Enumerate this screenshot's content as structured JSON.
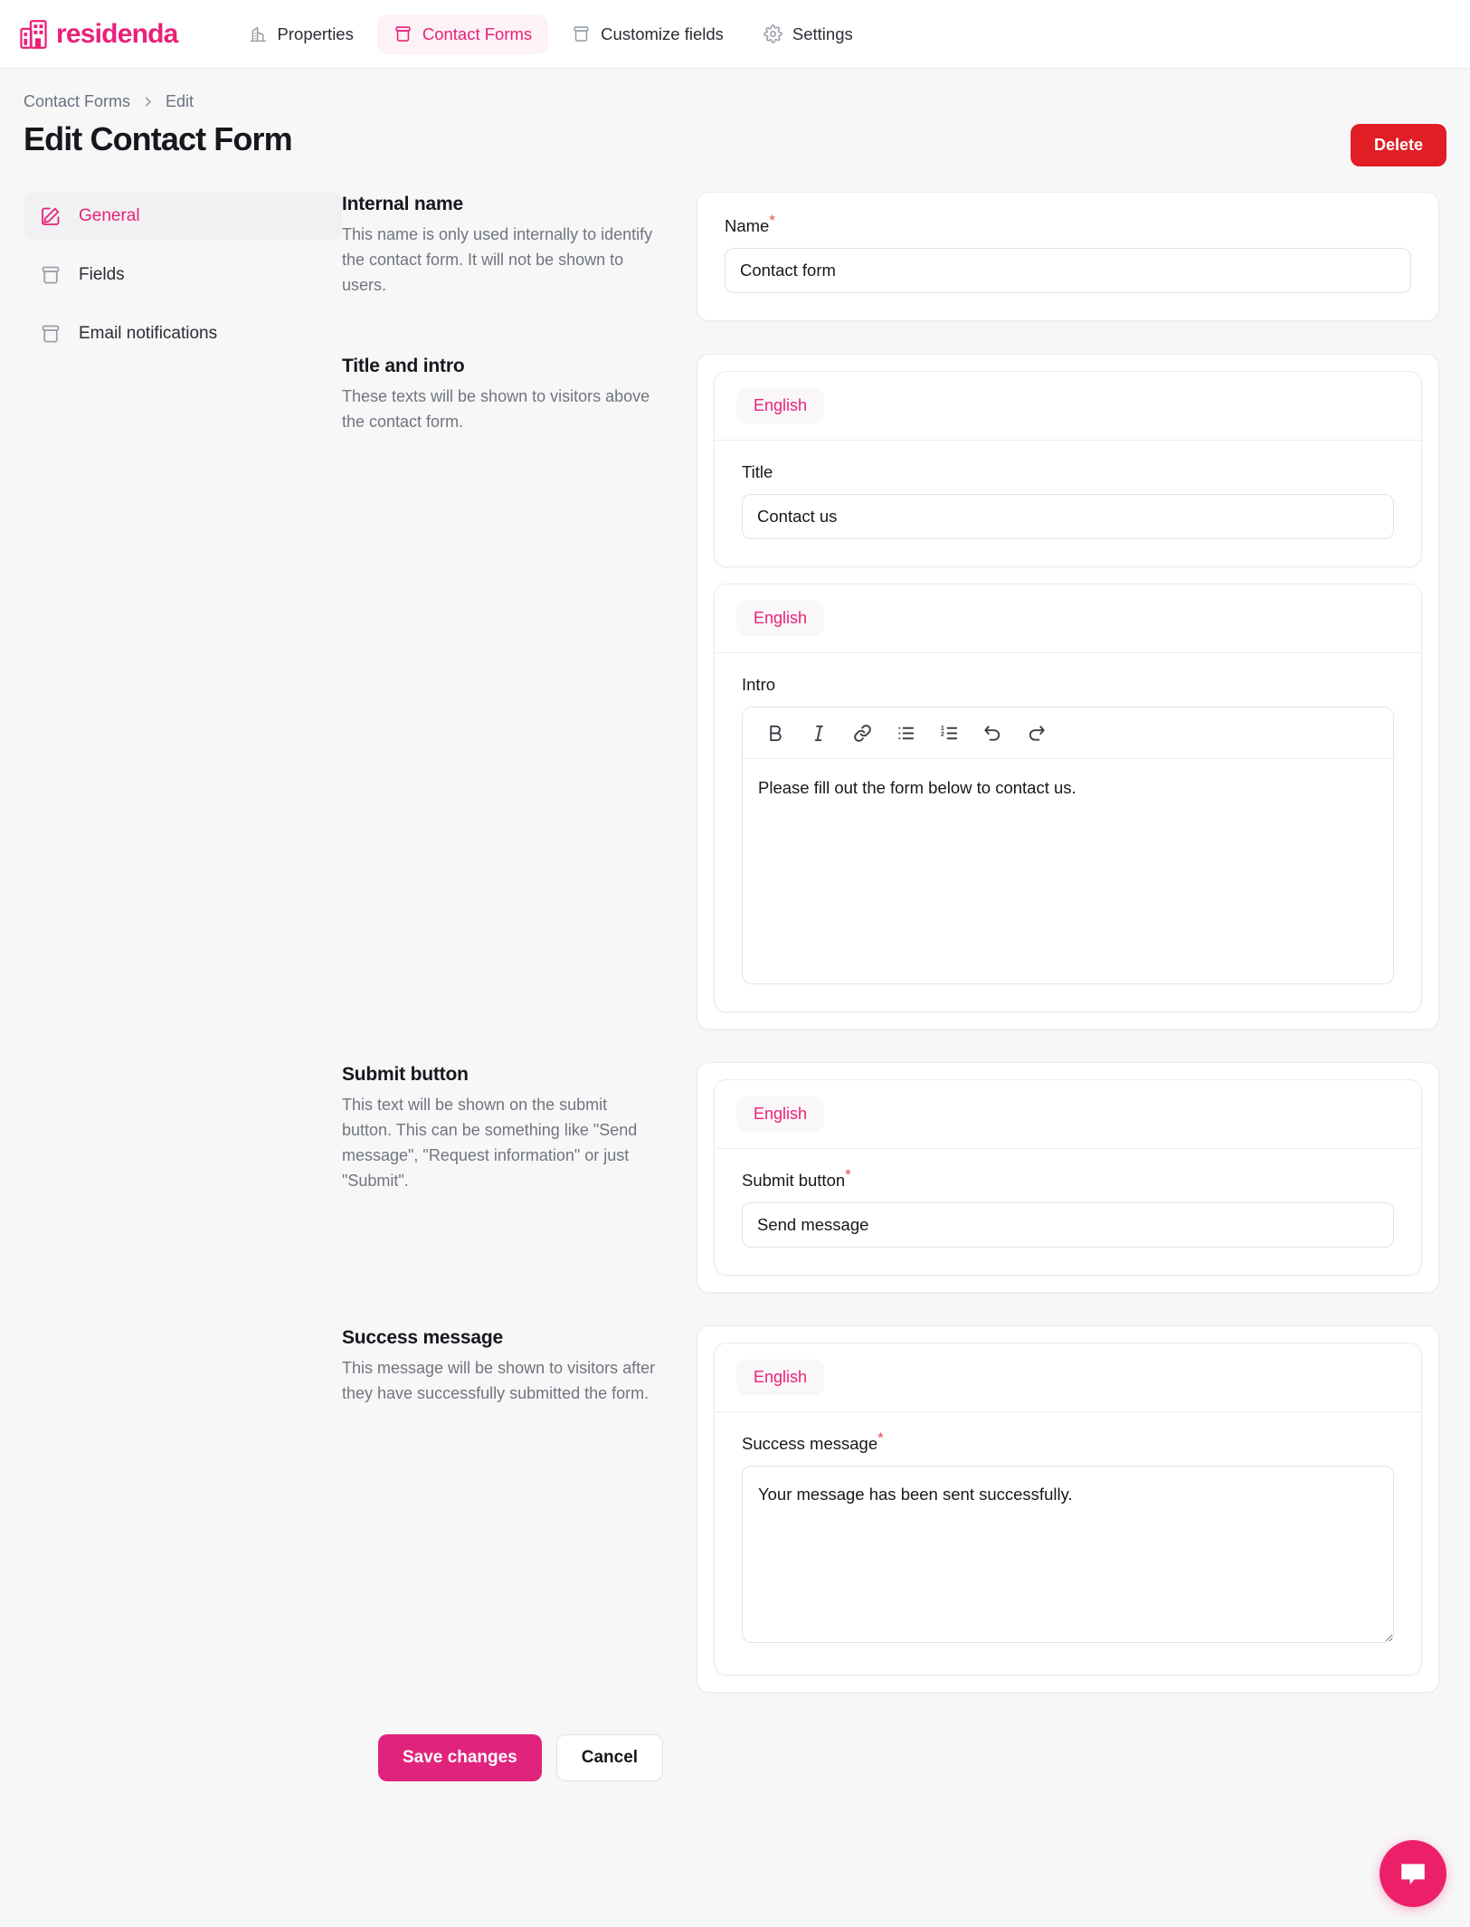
{
  "brand": {
    "name": "residenda",
    "accent": "#e8217a",
    "logo_icon": "building-icon"
  },
  "nav": {
    "items": [
      {
        "label": "Properties",
        "icon": "building-chart-icon",
        "active": false
      },
      {
        "label": "Contact Forms",
        "icon": "archive-box-icon",
        "active": true
      },
      {
        "label": "Customize fields",
        "icon": "archive-box-icon",
        "active": false
      },
      {
        "label": "Settings",
        "icon": "gear-icon",
        "active": false
      }
    ]
  },
  "breadcrumb": {
    "parent": "Contact Forms",
    "current": "Edit"
  },
  "header": {
    "title": "Edit Contact Form",
    "delete_label": "Delete",
    "delete_color": "#e11d26"
  },
  "sidebar": {
    "items": [
      {
        "label": "General",
        "icon": "pencil-square-icon",
        "active": true
      },
      {
        "label": "Fields",
        "icon": "archive-box-icon",
        "active": false
      },
      {
        "label": "Email notifications",
        "icon": "archive-box-icon",
        "active": false
      }
    ]
  },
  "sections": {
    "internal_name": {
      "title": "Internal name",
      "description": "This name is only used internally to identify the contact form. It will not be shown to users.",
      "field_label": "Name",
      "required_mark": "*",
      "value": "Contact form"
    },
    "title_intro": {
      "title": "Title and intro",
      "description": "These texts will be shown to visitors above the contact form.",
      "title_card": {
        "language": "English",
        "field_label": "Title",
        "value": "Contact us"
      },
      "intro_card": {
        "language": "English",
        "field_label": "Intro",
        "value": "Please fill out the form below to contact us.",
        "toolbar": [
          {
            "name": "bold-icon",
            "label": "B"
          },
          {
            "name": "italic-icon",
            "label": "I"
          },
          {
            "name": "link-icon",
            "label": "Link"
          },
          {
            "name": "bullet-list-icon",
            "label": "Bullet list"
          },
          {
            "name": "numbered-list-icon",
            "label": "Numbered list"
          },
          {
            "name": "undo-icon",
            "label": "Undo"
          },
          {
            "name": "redo-icon",
            "label": "Redo"
          }
        ]
      }
    },
    "submit_button": {
      "title": "Submit button",
      "description": "This text will be shown on the submit button. This can be something like \"Send message\", \"Request information\" or just \"Submit\".",
      "language": "English",
      "field_label": "Submit button",
      "required_mark": "*",
      "value": "Send message"
    },
    "success_message": {
      "title": "Success message",
      "description": "This message will be shown to visitors after they have successfully submitted the form.",
      "language": "English",
      "field_label": "Success message",
      "required_mark": "*",
      "value": "Your message has been sent successfully."
    }
  },
  "footer": {
    "save_label": "Save changes",
    "cancel_label": "Cancel",
    "save_color": "#e0247d"
  },
  "chat": {
    "icon": "chat-bubble-icon",
    "color": "#ec2069"
  }
}
